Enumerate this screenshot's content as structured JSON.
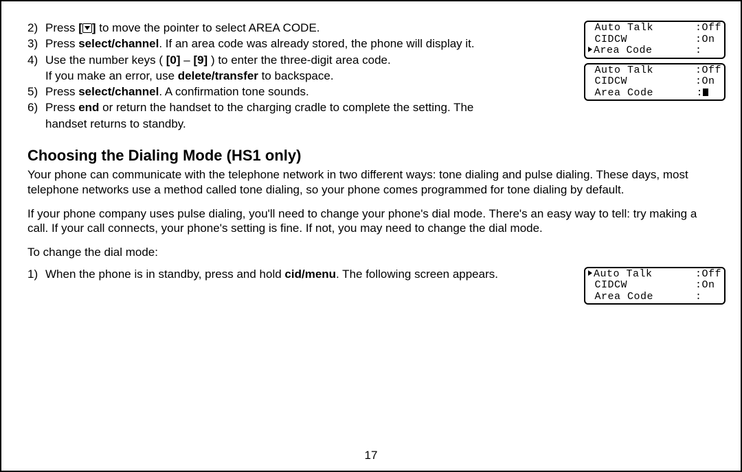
{
  "steps_top": {
    "s2a": "2)",
    "s2b": "Press ",
    "s2c": " to move the pointer to select AREA CODE.",
    "s3a": "3)",
    "s3b": "Press ",
    "s3c": "select/channel",
    "s3d": ". If an area code was already stored, the phone will display it.",
    "s4a": "4)",
    "s4b": "Use the number keys ( ",
    "s4c": "[0]",
    "s4d": " – ",
    "s4e": "[9]",
    "s4f": " ) to enter the three-digit area code.",
    "s4g": "If you make an error, use ",
    "s4h": "delete/transfer",
    "s4i": " to backspace.",
    "s5a": "5)",
    "s5b": "Press ",
    "s5c": "select/channel",
    "s5d": ". A confirmation tone sounds.",
    "s6a": "6)",
    "s6b": "Press ",
    "s6c": "end",
    "s6d": " or return the handset to the charging cradle to complete the setting. The",
    "s6e": "handset returns to standby."
  },
  "lcd1": {
    "r1_left": " Auto Talk",
    "r1_right": ":Off",
    "r2_left": " CIDCW",
    "r2_right": ":On ",
    "r3_left_ptr": true,
    "r3_left": "Area Code",
    "r3_right": ":   "
  },
  "lcd2": {
    "r1_left": " Auto Talk",
    "r1_right": ":Off",
    "r2_left": " CIDCW",
    "r2_right": ":On ",
    "r3_left": " Area Code",
    "r3_right": ":"
  },
  "section_heading": "Choosing the Dialing Mode (HS1 only)",
  "para1": "Your phone can communicate with the telephone network in two different ways: tone dialing and pulse dialing. These days, most telephone networks use a method called tone dialing, so your phone comes programmed for tone dialing by default.",
  "para2": "If your phone company uses pulse dialing, you'll need to change your phone's dial mode. There's an easy way to tell: try making a call. If your call connects, your phone's setting is fine. If not, you may need to change the dial mode.",
  "change_intro": "To change the dial mode:",
  "step_b1a": "1)",
  "step_b1b": "When the phone is in standby, press and hold ",
  "step_b1c": "cid/menu",
  "step_b1d": ". The following screen appears.",
  "lcd3": {
    "r1_left_ptr": true,
    "r1_left": "Auto Talk",
    "r1_right": ":Off",
    "r2_left": " CIDCW",
    "r2_right": ":On ",
    "r3_left": " Area Code",
    "r3_right": ":   "
  },
  "page_number": "17"
}
